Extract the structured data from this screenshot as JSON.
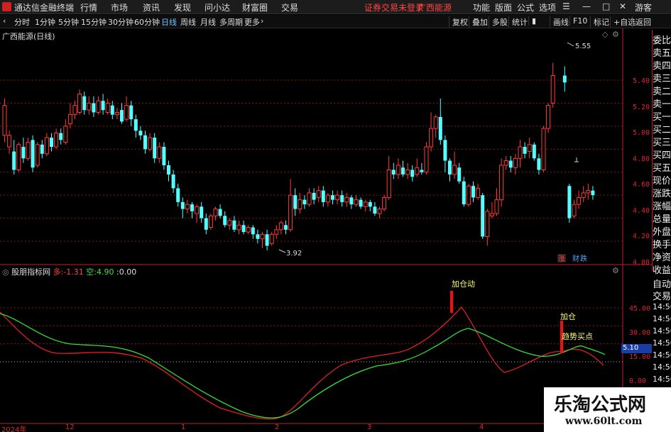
{
  "menubar": {
    "app_title": "通达信金融终端",
    "items": [
      "行情",
      "市场",
      "资讯",
      "发现",
      "问小达",
      "财富圈",
      "交易"
    ],
    "status": "证券交易未登录",
    "stock_name": "广西能源",
    "right_items": [
      "功能",
      "版面",
      "公式",
      "选项"
    ],
    "guest": "游客"
  },
  "toolbar": {
    "periods": [
      "分时",
      "1分钟",
      "5分钟",
      "15分钟",
      "30分钟",
      "60分钟",
      "日线",
      "周线",
      "月线",
      "多周期",
      "更多"
    ],
    "selected": "日线",
    "right_buttons": [
      "复权",
      "叠加",
      "多股",
      "统计",
      "画线",
      "F10",
      "标记",
      "+自选",
      "返回"
    ]
  },
  "price_panel": {
    "title": "广西能源(日线)",
    "high_label": "5.55",
    "low_label": "3.92",
    "axis": [
      "5.40",
      "5.20",
      "5.00",
      "4.80",
      "4.60",
      "4.40",
      "4.20",
      "4.00"
    ],
    "tags": [
      "涨",
      "财",
      "跌"
    ]
  },
  "indicator_panel": {
    "name": "股朋指标网",
    "duo_label": "多",
    "duo_value": "-1.31",
    "kong_label": "空",
    "kong_value": "4.90",
    "extra_value": "0.00",
    "axis": [
      "45.00",
      "30.00",
      "15.00",
      "0.00"
    ],
    "right_value": "5.10",
    "annotations": [
      "加仓动",
      "加仓",
      "趋势买点"
    ]
  },
  "sidebar": {
    "items": [
      "委比",
      "卖五",
      "卖四",
      "卖三",
      "卖二",
      "卖一",
      "买一",
      "买二",
      "买三",
      "买四",
      "买五",
      "现价",
      "涨跌",
      "涨幅",
      "总量",
      "外盘",
      "换手",
      "净资",
      "收益",
      "自动",
      "交易"
    ],
    "times": [
      "14:56",
      "14:56",
      "14:56",
      "14:56",
      "14:56",
      "14:56",
      "14:56"
    ]
  },
  "date_axis": [
    "2024年",
    "12",
    "1",
    "2",
    "3",
    "4"
  ],
  "watermark": {
    "title": "乐淘公式网",
    "url": "www.60lt.com"
  },
  "chart_data": {
    "type": "candlestick",
    "ylim": [
      3.85,
      5.65
    ],
    "candles": [
      [
        4.92,
        5.18,
        5.24,
        4.86
      ],
      [
        4.82,
        4.92,
        4.96,
        4.76
      ],
      [
        4.78,
        4.62,
        4.88,
        4.58
      ],
      [
        4.62,
        4.84,
        4.86,
        4.6
      ],
      [
        4.82,
        4.72,
        4.9,
        4.68
      ],
      [
        4.72,
        4.86,
        4.9,
        4.7
      ],
      [
        4.88,
        4.64,
        4.92,
        4.6
      ],
      [
        4.66,
        4.84,
        4.86,
        4.64
      ],
      [
        4.84,
        4.76,
        4.88,
        4.72
      ],
      [
        4.76,
        4.9,
        4.94,
        4.74
      ],
      [
        4.9,
        4.82,
        4.94,
        4.78
      ],
      [
        4.82,
        4.94,
        4.98,
        4.8
      ],
      [
        4.94,
        4.88,
        4.98,
        4.84
      ],
      [
        4.86,
        5.0,
        5.06,
        4.84
      ],
      [
        5.02,
        5.1,
        5.2,
        4.98
      ],
      [
        5.1,
        5.18,
        5.22,
        5.06
      ],
      [
        5.12,
        5.28,
        5.32,
        5.1
      ],
      [
        5.26,
        5.14,
        5.3,
        5.1
      ],
      [
        5.14,
        5.2,
        5.26,
        5.1
      ],
      [
        5.2,
        5.12,
        5.26,
        5.08
      ],
      [
        5.12,
        5.22,
        5.26,
        5.1
      ],
      [
        5.22,
        5.14,
        5.28,
        5.1
      ],
      [
        5.12,
        5.2,
        5.24,
        5.1
      ],
      [
        5.18,
        5.1,
        5.22,
        5.06
      ],
      [
        5.1,
        5.12,
        5.16,
        5.06
      ],
      [
        5.14,
        5.04,
        5.2,
        5.02
      ],
      [
        5.06,
        5.18,
        5.26,
        5.04
      ],
      [
        5.18,
        5.06,
        5.22,
        5.0
      ],
      [
        5.06,
        4.96,
        5.1,
        4.9
      ],
      [
        4.96,
        4.92,
        5.0,
        4.88
      ],
      [
        4.92,
        4.8,
        4.96,
        4.76
      ],
      [
        4.8,
        4.9,
        4.94,
        4.78
      ],
      [
        4.9,
        4.72,
        4.94,
        4.68
      ],
      [
        4.72,
        4.82,
        4.86,
        4.68
      ],
      [
        4.82,
        4.66,
        4.86,
        4.62
      ],
      [
        4.66,
        4.58,
        4.7,
        4.52
      ],
      [
        4.58,
        4.46,
        4.62,
        4.42
      ],
      [
        4.46,
        4.34,
        4.5,
        4.3
      ],
      [
        4.34,
        4.28,
        4.38,
        4.2
      ],
      [
        4.28,
        4.32,
        4.36,
        4.24
      ],
      [
        4.32,
        4.26,
        4.34,
        4.2
      ],
      [
        4.24,
        4.3,
        4.32,
        4.16
      ],
      [
        4.3,
        4.2,
        4.34,
        4.16
      ],
      [
        4.2,
        4.1,
        4.24,
        4.06
      ],
      [
        4.12,
        4.22,
        4.24,
        4.1
      ],
      [
        4.22,
        4.28,
        4.3,
        4.18
      ],
      [
        4.28,
        4.22,
        4.32,
        4.2
      ],
      [
        4.22,
        4.14,
        4.26,
        4.12
      ],
      [
        4.14,
        4.18,
        4.2,
        4.1
      ],
      [
        4.18,
        4.1,
        4.22,
        4.08
      ],
      [
        4.1,
        4.14,
        4.18,
        4.06
      ],
      [
        4.14,
        4.08,
        4.18,
        4.06
      ],
      [
        4.08,
        4.12,
        4.14,
        4.06
      ],
      [
        4.12,
        4.06,
        4.14,
        4.02
      ],
      [
        4.06,
        4.02,
        4.1,
        3.98
      ],
      [
        4.02,
        4.06,
        4.08,
        3.94
      ],
      [
        4.06,
        3.96,
        4.1,
        3.92
      ],
      [
        3.98,
        4.06,
        4.08,
        3.96
      ],
      [
        4.06,
        4.1,
        4.14,
        4.02
      ],
      [
        4.1,
        4.16,
        4.18,
        4.06
      ],
      [
        4.14,
        4.1,
        4.18,
        4.06
      ],
      [
        4.1,
        4.4,
        4.54,
        4.08
      ],
      [
        4.4,
        4.28,
        4.46,
        4.22
      ],
      [
        4.28,
        4.36,
        4.42,
        4.24
      ],
      [
        4.36,
        4.32,
        4.4,
        4.28
      ],
      [
        4.32,
        4.42,
        4.46,
        4.3
      ],
      [
        4.42,
        4.36,
        4.46,
        4.32
      ],
      [
        4.38,
        4.44,
        4.48,
        4.34
      ],
      [
        4.44,
        4.34,
        4.48,
        4.3
      ],
      [
        4.34,
        4.4,
        4.42,
        4.3
      ],
      [
        4.4,
        4.36,
        4.44,
        4.32
      ],
      [
        4.36,
        4.4,
        4.44,
        4.32
      ],
      [
        4.4,
        4.34,
        4.44,
        4.3
      ],
      [
        4.34,
        4.38,
        4.42,
        4.3
      ],
      [
        4.38,
        4.32,
        4.4,
        4.28
      ],
      [
        4.32,
        4.36,
        4.4,
        4.3
      ],
      [
        4.36,
        4.3,
        4.38,
        4.28
      ],
      [
        4.3,
        4.34,
        4.36,
        4.26
      ],
      [
        4.34,
        4.3,
        4.36,
        4.26
      ],
      [
        4.3,
        4.24,
        4.34,
        4.22
      ],
      [
        4.24,
        4.28,
        4.3,
        4.2
      ],
      [
        4.28,
        4.38,
        4.4,
        4.26
      ],
      [
        4.38,
        4.62,
        4.74,
        4.36
      ],
      [
        4.62,
        4.58,
        4.68,
        4.54
      ],
      [
        4.58,
        4.66,
        4.72,
        4.54
      ],
      [
        4.64,
        4.58,
        4.7,
        4.56
      ],
      [
        4.58,
        4.62,
        4.68,
        4.54
      ],
      [
        4.62,
        4.56,
        4.66,
        4.52
      ],
      [
        4.58,
        4.64,
        4.72,
        4.56
      ],
      [
        4.62,
        4.6,
        4.68,
        4.58
      ],
      [
        4.6,
        4.82,
        4.86,
        4.58
      ],
      [
        4.82,
        4.98,
        5.12,
        4.78
      ],
      [
        4.98,
        5.08,
        5.1,
        4.9
      ],
      [
        5.08,
        4.88,
        5.24,
        4.84
      ],
      [
        4.88,
        4.7,
        4.92,
        4.6
      ],
      [
        4.7,
        4.58,
        4.72,
        4.52
      ],
      [
        4.58,
        4.66,
        4.78,
        4.54
      ],
      [
        4.64,
        4.52,
        4.68,
        4.5
      ],
      [
        4.52,
        4.32,
        4.56,
        4.3
      ],
      [
        4.32,
        4.48,
        4.5,
        4.3
      ],
      [
        4.48,
        4.38,
        4.52,
        4.34
      ],
      [
        4.38,
        4.46,
        4.5,
        4.36
      ],
      [
        4.4,
        4.04,
        4.42,
        4.02
      ],
      [
        4.04,
        4.26,
        4.28,
        3.96
      ],
      [
        4.22,
        4.24,
        4.34,
        4.2
      ],
      [
        4.24,
        4.36,
        4.46,
        4.22
      ],
      [
        4.36,
        4.66,
        4.72,
        4.3
      ],
      [
        4.66,
        4.7,
        4.74,
        4.62
      ],
      [
        4.7,
        4.64,
        4.74,
        4.6
      ],
      [
        4.64,
        4.72,
        4.76,
        4.58
      ],
      [
        4.72,
        4.82,
        4.88,
        4.64
      ],
      [
        4.82,
        4.76,
        4.86,
        4.72
      ],
      [
        4.78,
        4.84,
        4.9,
        4.72
      ],
      [
        4.84,
        4.72,
        4.86,
        4.7
      ],
      [
        4.72,
        4.62,
        4.76,
        4.58
      ],
      [
        4.62,
        4.98,
        5.0,
        4.6
      ],
      [
        4.98,
        5.18,
        5.2,
        4.94
      ],
      [
        5.2,
        5.44,
        5.55,
        5.16
      ],
      [
        5.44,
        5.38,
        5.52,
        5.3
      ],
      [
        4.48,
        4.2,
        4.5,
        4.16
      ],
      [
        4.22,
        4.32,
        4.36,
        4.2
      ],
      [
        4.32,
        4.38,
        4.44,
        4.28
      ],
      [
        4.38,
        4.42,
        4.48,
        4.34
      ],
      [
        4.42,
        4.44,
        4.5,
        4.36
      ],
      [
        4.44,
        4.4,
        4.48,
        4.36
      ]
    ]
  }
}
